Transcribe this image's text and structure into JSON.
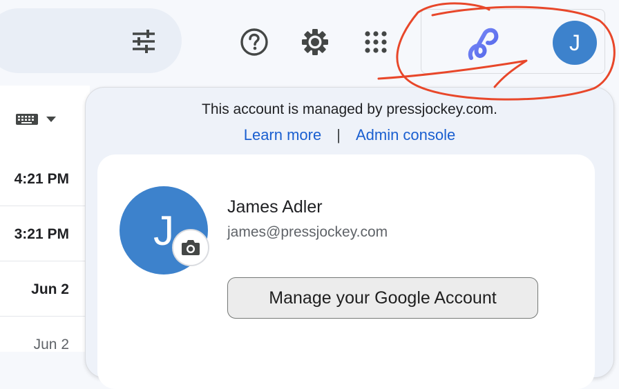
{
  "header": {
    "icons": {
      "tune": "tune-icon",
      "help": "help-icon",
      "settings": "gear-icon",
      "apps": "apps-grid-icon"
    },
    "avatar_initial": "J",
    "accent": "#3d82cc",
    "annotation_color": "#e8472a"
  },
  "mail_list": {
    "rows": [
      {
        "time": "4:21 PM"
      },
      {
        "time": "3:21 PM"
      },
      {
        "time": "Jun 2"
      },
      {
        "time": "Jun 2"
      }
    ]
  },
  "account_popup": {
    "managed_text": "This account is managed by pressjockey.com.",
    "learn_more": "Learn more",
    "separator": "|",
    "admin_console": "Admin console",
    "avatar_initial": "J",
    "name": "James Adler",
    "email": "james@pressjockey.com",
    "manage_button": "Manage your Google Account",
    "link_color": "#1a5fd0"
  }
}
